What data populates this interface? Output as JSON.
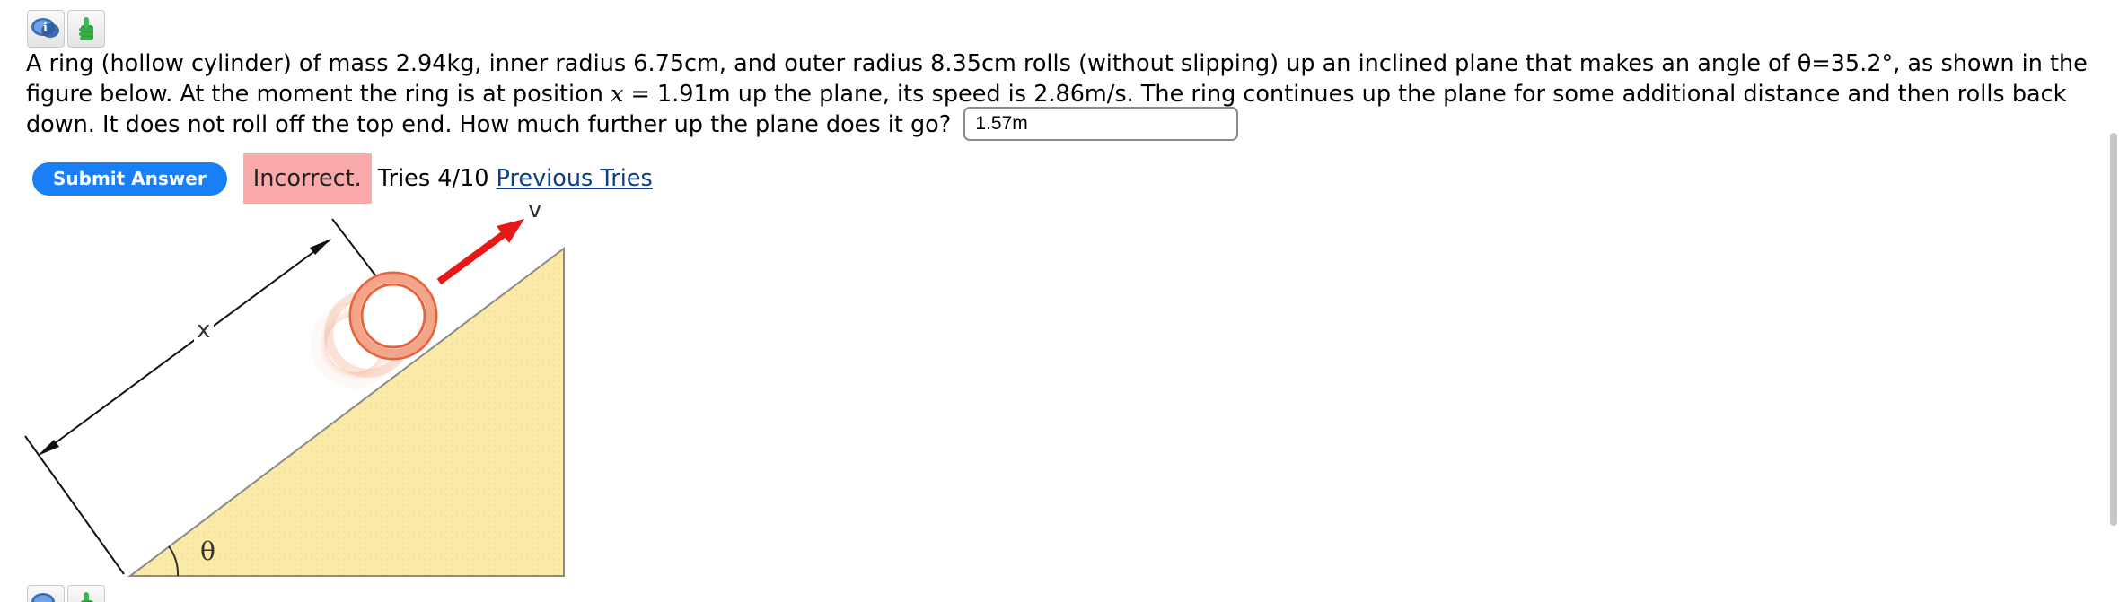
{
  "toolbar": {
    "icons": [
      "discussion-icon",
      "thumbs-up-icon"
    ]
  },
  "question": {
    "text_part1": "A ring (hollow cylinder) of mass 2.94kg, inner radius 6.75cm, and outer radius 8.35cm rolls (without slipping) up an inclined plane that makes an angle of θ=35.2°, as shown in the figure below. At the moment the ring is at position ",
    "var_x": "x",
    "text_part2": " = 1.91m up the plane, its speed is 2.86m/s. The ring continues up the plane for some additional distance and then rolls back down. It does not roll off the top end. How much further up the plane does it go?"
  },
  "answer": {
    "value": "1.57m"
  },
  "submit": {
    "label": "Submit Answer",
    "status": "Incorrect.",
    "tries": "Tries 4/10",
    "previous_tries": "Previous Tries"
  },
  "figure": {
    "label_x": "x",
    "label_v": "v",
    "label_theta": "θ",
    "incline_color": "#fbeaa8",
    "arrow_color": "#e81818",
    "ring_color": "#e8623a"
  }
}
